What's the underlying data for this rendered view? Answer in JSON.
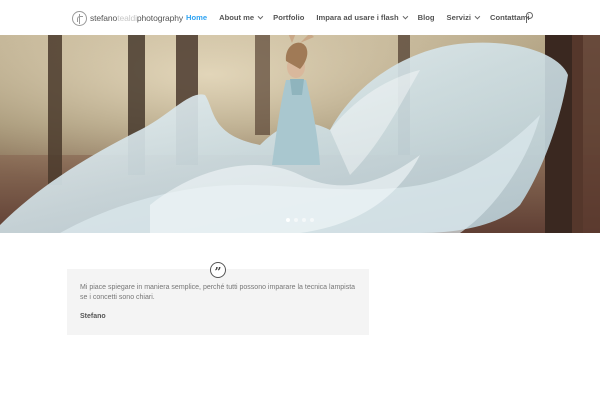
{
  "header": {
    "logo": {
      "part1": "stefano",
      "part2": "tealdi",
      "part3": "photography"
    },
    "nav": [
      {
        "label": "Home",
        "active": true,
        "dropdown": false
      },
      {
        "label": "About me",
        "active": false,
        "dropdown": true
      },
      {
        "label": "Portfolio",
        "active": false,
        "dropdown": false
      },
      {
        "label": "Impara ad usare i flash",
        "active": false,
        "dropdown": true
      },
      {
        "label": "Blog",
        "active": false,
        "dropdown": false
      },
      {
        "label": "Servizi",
        "active": false,
        "dropdown": true
      },
      {
        "label": "Contattami",
        "active": false,
        "dropdown": false
      }
    ],
    "search_icon": "search-icon"
  },
  "hero": {
    "slide_count": 4,
    "active_slide": 1
  },
  "testimonial": {
    "quote_icon": "quote-icon",
    "text": "Mi piace spiegare in maniera semplice, perché tutti possono imparare la tecnica lampista se i concetti sono chiari.",
    "author": "Stefano"
  },
  "colors": {
    "accent": "#2ea3f2",
    "nav_text": "#555555",
    "testimonial_bg": "#f4f4f4"
  }
}
